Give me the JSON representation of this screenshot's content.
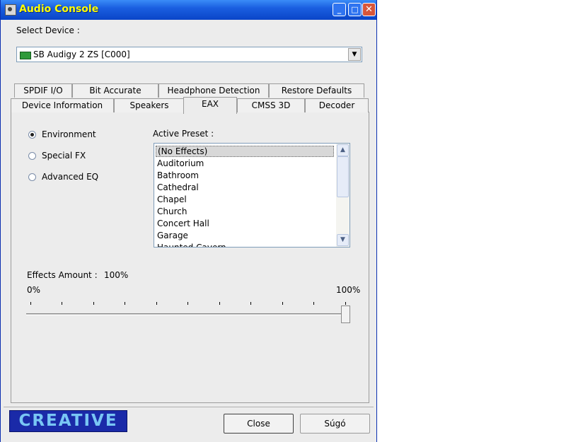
{
  "window": {
    "title": "Audio Console"
  },
  "device": {
    "label": "Select Device :",
    "selected": "SB Audigy 2 ZS [C000]"
  },
  "tabs_row1": [
    "SPDIF I/O",
    "Bit Accurate",
    "Headphone Detection",
    "Restore Defaults"
  ],
  "tabs_row2": [
    "Device Information",
    "Speakers",
    "EAX",
    "CMSS 3D",
    "Decoder"
  ],
  "active_tab": "EAX",
  "modes": [
    {
      "label": "Environment",
      "selected": true
    },
    {
      "label": "Special FX",
      "selected": false
    },
    {
      "label": "Advanced EQ",
      "selected": false
    }
  ],
  "preset": {
    "label": "Active Preset :",
    "items": [
      "(No Effects)",
      "Auditorium",
      "Bathroom",
      "Cathedral",
      "Chapel",
      "Church",
      "Concert Hall",
      "Garage",
      "Haunted Cavern"
    ],
    "selected": "(No Effects)"
  },
  "effects": {
    "label": "Effects Amount :",
    "value": "100%",
    "min_label": "0%",
    "max_label": "100%",
    "level": 1.0
  },
  "footer": {
    "logo_text": "CREATIVE",
    "close": "Close",
    "help": "Súgó"
  }
}
